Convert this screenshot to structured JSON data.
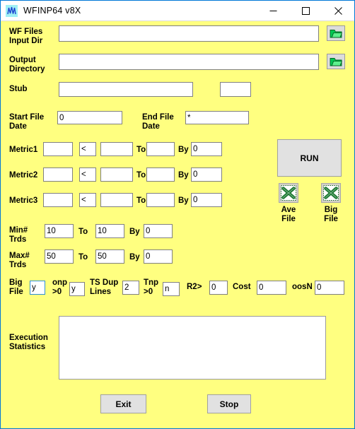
{
  "window": {
    "title": "WFINP64 v8X",
    "icon": "waveform-icon",
    "background_color": "#ffff80",
    "border_color": "#0078d7",
    "controls": [
      {
        "name": "minimize",
        "glyph": "—"
      },
      {
        "name": "maximize",
        "glyph": "□"
      },
      {
        "name": "close",
        "glyph": "✕"
      }
    ]
  },
  "form": {
    "wf_files_input_dir": {
      "label": "WF Files\nInput Dir",
      "value": "",
      "browse_icon": "folder-icon"
    },
    "output_directory": {
      "label": "Output\nDirectory",
      "value": "",
      "browse_icon": "folder-icon"
    },
    "stub": {
      "label": "Stub",
      "value": "",
      "extra_value": ""
    },
    "start_file_date": {
      "label": "Start File\nDate",
      "value": "0"
    },
    "end_file_date": {
      "label": "End File\nDate",
      "value": "*"
    },
    "to_label": "To",
    "by_label": "By",
    "metrics": [
      {
        "label": "Metric1",
        "name": "",
        "op": "<",
        "low": "",
        "high": "",
        "by": "0"
      },
      {
        "label": "Metric2",
        "name": "",
        "op": "<",
        "low": "",
        "high": "",
        "by": "0"
      },
      {
        "label": "Metric3",
        "name": "",
        "op": "<",
        "low": "",
        "high": "",
        "by": "0"
      }
    ],
    "min_trds": {
      "label": "Min#\nTrds",
      "from": "10",
      "to": "10",
      "by": "0"
    },
    "max_trds": {
      "label": "Max#\nTrds",
      "from": "50",
      "to": "50",
      "by": "0"
    },
    "options": {
      "big_file": {
        "label": "Big\nFile",
        "value": "y",
        "focused": true
      },
      "onp": {
        "label": "onp\n>0",
        "value": "y"
      },
      "ts_dup_lines": {
        "label": "TS Dup\nLines",
        "value": "2"
      },
      "tnp": {
        "label": "Tnp\n>0",
        "value": "n"
      },
      "r2": {
        "label": "R2>",
        "value": "0"
      },
      "cost": {
        "label": "Cost",
        "value": "0"
      },
      "oosn": {
        "label": "oosN",
        "value": "0"
      }
    },
    "execution_statistics": {
      "label": "Execution\nStatistics",
      "value": ""
    }
  },
  "buttons": {
    "run": "RUN",
    "ave_file": "Ave\nFile",
    "big_file": "Big\nFile",
    "exit": "Exit",
    "stop": "Stop"
  }
}
